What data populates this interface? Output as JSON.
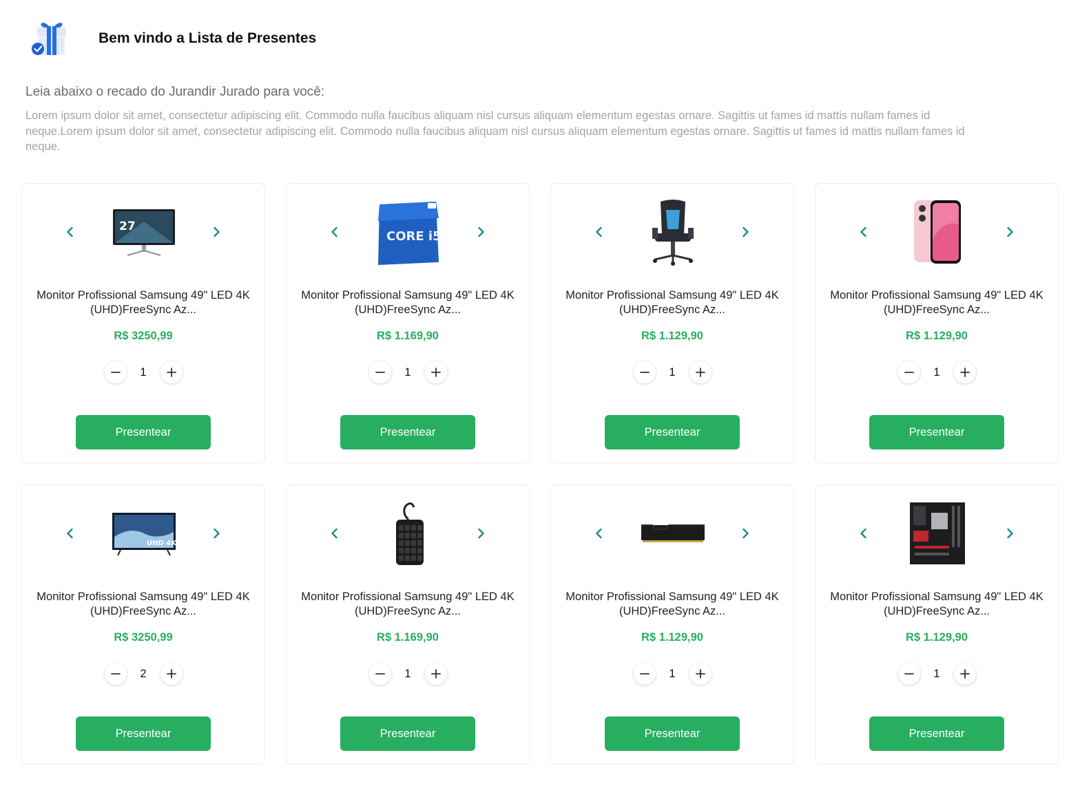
{
  "header": {
    "title": "Bem vindo a Lista de Presentes",
    "logo_icon": "gift-box-icon"
  },
  "intro": {
    "heading": "Leia abaixo o recado do Jurandir Jurado para você:",
    "body": "Lorem ipsum dolor sit amet, consectetur adipiscing elit. Commodo nulla faucibus aliquam nisl cursus aliquam elementum egestas ornare. Sagittis ut fames id mattis nullam fames id neque.Lorem ipsum dolor sit amet, consectetur adipiscing elit. Commodo nulla faucibus aliquam nisl cursus aliquam elementum egestas ornare. Sagittis ut fames id mattis nullam fames id neque."
  },
  "colors": {
    "accent_green": "#27ae60",
    "arrow_teal": "#1e8a8a"
  },
  "products": [
    {
      "name": "Monitor Profissional Samsung 49\" LED 4K (UHD)FreeSync Az...",
      "price": "R$ 3250,99",
      "qty": "1",
      "button": "Presentear",
      "image": "monitor-image",
      "image_text": "27"
    },
    {
      "name": "Monitor Profissional Samsung 49\" LED 4K (UHD)FreeSync Az...",
      "price": "R$ 1.169,90",
      "qty": "1",
      "button": "Presentear",
      "image": "cpu-box-image",
      "image_text": "CORE i5"
    },
    {
      "name": "Monitor Profissional Samsung 49\" LED 4K (UHD)FreeSync Az...",
      "price": "R$ 1.129,90",
      "qty": "1",
      "button": "Presentear",
      "image": "gaming-chair-image",
      "image_text": ""
    },
    {
      "name": "Monitor Profissional Samsung 49\" LED 4K (UHD)FreeSync Az...",
      "price": "R$ 1.129,90",
      "qty": "1",
      "button": "Presentear",
      "image": "smartphone-image",
      "image_text": ""
    },
    {
      "name": "Monitor Profissional Samsung 49\" LED 4K (UHD)FreeSync Az...",
      "price": "R$ 3250,99",
      "qty": "2",
      "button": "Presentear",
      "image": "tv-image",
      "image_text": "UHD 4K"
    },
    {
      "name": "Monitor Profissional Samsung 49\" LED 4K (UHD)FreeSync Az...",
      "price": "R$ 1.169,90",
      "qty": "1",
      "button": "Presentear",
      "image": "keypad-image",
      "image_text": ""
    },
    {
      "name": "Monitor Profissional Samsung 49\" LED 4K (UHD)FreeSync Az...",
      "price": "R$ 1.129,90",
      "qty": "1",
      "button": "Presentear",
      "image": "ram-module-image",
      "image_text": ""
    },
    {
      "name": "Monitor Profissional Samsung 49\" LED 4K (UHD)FreeSync Az...",
      "price": "R$ 1.129,90",
      "qty": "1",
      "button": "Presentear",
      "image": "motherboard-image",
      "image_text": ""
    }
  ]
}
